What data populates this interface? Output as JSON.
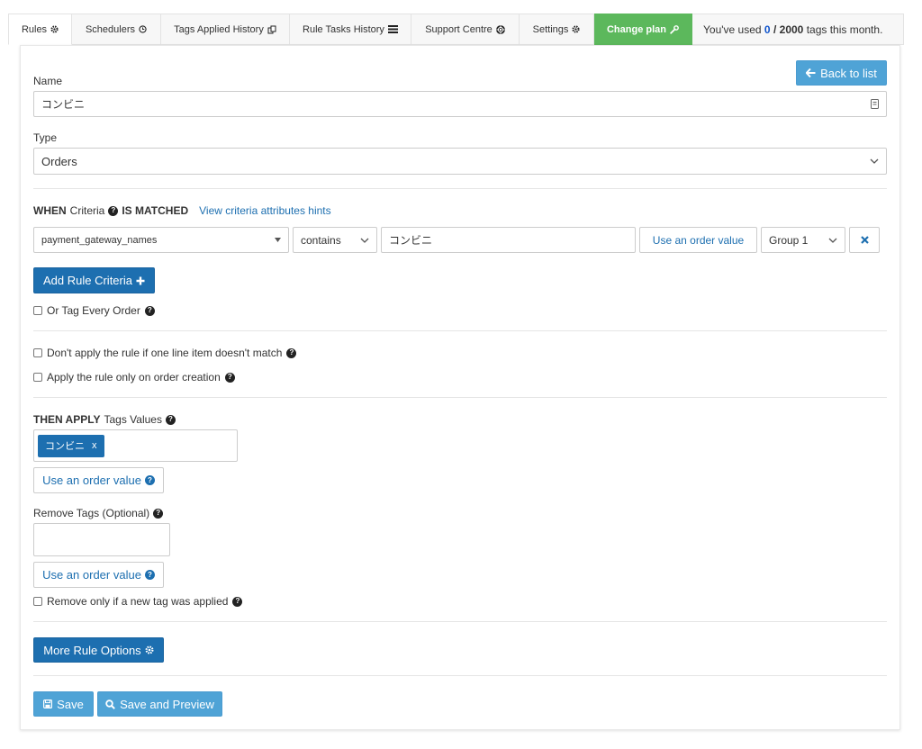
{
  "tabs": [
    {
      "label": "Rules",
      "icon": "gear-icon",
      "active": true
    },
    {
      "label": "Schedulers",
      "icon": "clock-icon"
    },
    {
      "label": "Tags Applied History",
      "icon": "copy-icon"
    },
    {
      "label": "Rule Tasks History",
      "icon": "list-icon"
    },
    {
      "label": "Support Centre",
      "icon": "lifebuoy-icon"
    },
    {
      "label": "Settings",
      "icon": "gear-icon"
    },
    {
      "label": "Change plan",
      "icon": "wrench-icon"
    }
  ],
  "usage": {
    "prefix": "You've used",
    "used": "0",
    "separator": "/",
    "limit": "2000",
    "suffix": "tags this month."
  },
  "back_button": "Back to list",
  "name": {
    "label": "Name",
    "value": "コンビニ"
  },
  "type": {
    "label": "Type",
    "value": "Orders"
  },
  "criteria": {
    "when": "WHEN",
    "criteria_word": "Criteria",
    "is_matched": "IS MATCHED",
    "hints_link": "View criteria attributes hints",
    "attribute": "payment_gateway_names",
    "operator": "contains",
    "value": "コンビニ",
    "order_value_button": "Use an order value",
    "group": "Group 1"
  },
  "add_rule_criteria": "Add Rule Criteria",
  "or_tag_every_order": "Or Tag Every Order",
  "dont_apply_line_item": "Don't apply the rule if one line item doesn't match",
  "apply_on_creation": "Apply the rule only on order creation",
  "then_apply": {
    "bold": "THEN APPLY",
    "rest": "Tags Values"
  },
  "tags": [
    {
      "label": "コンビニ",
      "remove": "x"
    }
  ],
  "use_order_value": "Use an order value",
  "remove_tags_label": "Remove Tags (Optional)",
  "remove_only_if_new": "Remove only if a new tag was applied",
  "more_rule_options": "More Rule Options",
  "save": "Save",
  "save_and_preview": "Save and Preview",
  "colors": {
    "primary": "#1d6fb0",
    "light_primary": "#4fa3d6",
    "green": "#5cb85c"
  }
}
